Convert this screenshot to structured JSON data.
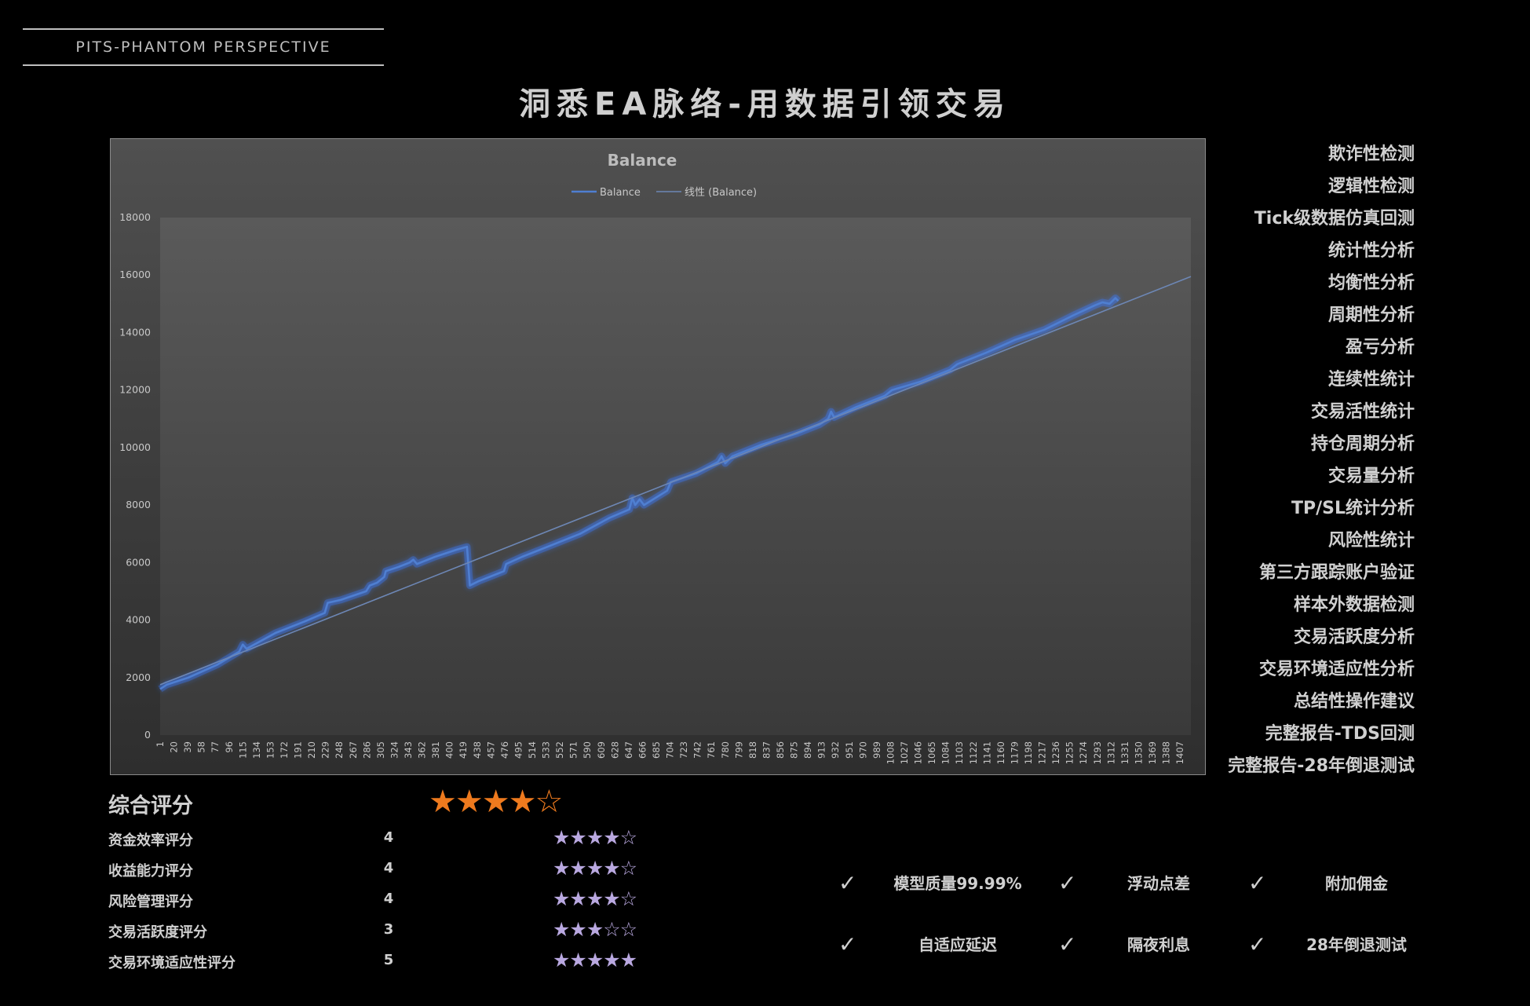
{
  "brand": "PITS-PHANTOM PERSPECTIVE",
  "main_title": "洞悉EA脉络-用数据引领交易",
  "chart_data": {
    "type": "line",
    "title": "Balance",
    "legend": [
      "Balance",
      "线性 (Balance)"
    ],
    "legend_position": "top",
    "ylim": [
      0,
      18000
    ],
    "yticks": [
      0,
      2000,
      4000,
      6000,
      8000,
      10000,
      12000,
      14000,
      16000,
      18000
    ],
    "xlim": [
      1,
      1422
    ],
    "xticks": [
      1,
      20,
      39,
      58,
      77,
      96,
      115,
      134,
      153,
      172,
      191,
      210,
      229,
      248,
      267,
      286,
      305,
      324,
      343,
      362,
      381,
      400,
      419,
      438,
      457,
      476,
      495,
      514,
      533,
      552,
      571,
      590,
      609,
      628,
      647,
      666,
      685,
      704,
      723,
      742,
      761,
      780,
      799,
      818,
      837,
      856,
      875,
      894,
      913,
      932,
      951,
      970,
      989,
      1008,
      1027,
      1046,
      1065,
      1084,
      1103,
      1122,
      1141,
      1160,
      1179,
      1198,
      1217,
      1236,
      1255,
      1274,
      1293,
      1312,
      1331,
      1350,
      1369,
      1388,
      1407
    ],
    "grid": false,
    "series": [
      {
        "name": "Balance",
        "color": "#4f7fd1",
        "points": [
          [
            1,
            1600
          ],
          [
            10,
            1750
          ],
          [
            40,
            2000
          ],
          [
            80,
            2450
          ],
          [
            110,
            2900
          ],
          [
            115,
            3150
          ],
          [
            120,
            3000
          ],
          [
            160,
            3550
          ],
          [
            200,
            3950
          ],
          [
            228,
            4250
          ],
          [
            232,
            4600
          ],
          [
            250,
            4700
          ],
          [
            285,
            5000
          ],
          [
            290,
            5200
          ],
          [
            300,
            5300
          ],
          [
            310,
            5500
          ],
          [
            312,
            5700
          ],
          [
            330,
            5850
          ],
          [
            345,
            6000
          ],
          [
            350,
            6100
          ],
          [
            355,
            5950
          ],
          [
            380,
            6200
          ],
          [
            410,
            6450
          ],
          [
            424,
            6550
          ],
          [
            428,
            5200
          ],
          [
            440,
            5350
          ],
          [
            475,
            5700
          ],
          [
            478,
            5950
          ],
          [
            500,
            6200
          ],
          [
            540,
            6600
          ],
          [
            580,
            7000
          ],
          [
            620,
            7550
          ],
          [
            648,
            7850
          ],
          [
            652,
            8250
          ],
          [
            656,
            8000
          ],
          [
            662,
            8200
          ],
          [
            668,
            8000
          ],
          [
            700,
            8500
          ],
          [
            705,
            8800
          ],
          [
            740,
            9100
          ],
          [
            770,
            9500
          ],
          [
            775,
            9700
          ],
          [
            780,
            9450
          ],
          [
            790,
            9700
          ],
          [
            830,
            10100
          ],
          [
            880,
            10500
          ],
          [
            910,
            10800
          ],
          [
            922,
            11000
          ],
          [
            926,
            11250
          ],
          [
            930,
            11050
          ],
          [
            960,
            11400
          ],
          [
            1000,
            11800
          ],
          [
            1010,
            12000
          ],
          [
            1050,
            12300
          ],
          [
            1090,
            12700
          ],
          [
            1100,
            12900
          ],
          [
            1140,
            13300
          ],
          [
            1180,
            13750
          ],
          [
            1220,
            14100
          ],
          [
            1260,
            14600
          ],
          [
            1290,
            14950
          ],
          [
            1300,
            15050
          ],
          [
            1310,
            15000
          ],
          [
            1318,
            15200
          ],
          [
            1322,
            15100
          ]
        ]
      },
      {
        "name": "线性 (Balance)",
        "color": "#6d87b5",
        "points": [
          [
            1,
            1750
          ],
          [
            1422,
            15950
          ]
        ]
      }
    ]
  },
  "side_items": [
    "欺诈性检测",
    "逻辑性检测",
    "Tick级数据仿真回测",
    "统计性分析",
    "均衡性分析",
    "周期性分析",
    "盈亏分析",
    "连续性统计",
    "交易活性统计",
    "持仓周期分析",
    "交易量分析",
    "TP/SL统计分析",
    "风险性统计",
    "第三方跟踪账户验证",
    "样本外数据检测",
    "交易活跃度分析",
    "交易环境适应性分析",
    "总结性操作建议",
    "完整报告-TDS回测",
    "完整报告-28年倒退测试"
  ],
  "overall": {
    "label": "综合评分",
    "stars": "★★★★☆"
  },
  "scores": [
    {
      "label": "资金效率评分",
      "value": "4",
      "stars": "★★★★☆"
    },
    {
      "label": "收益能力评分",
      "value": "4",
      "stars": "★★★★☆"
    },
    {
      "label": "风险管理评分",
      "value": "4",
      "stars": "★★★★☆"
    },
    {
      "label": "交易活跃度评分",
      "value": "3",
      "stars": "★★★☆☆"
    },
    {
      "label": "交易环境适应性评分",
      "value": "5",
      "stars": "★★★★★"
    }
  ],
  "features": [
    {
      "check": "✓",
      "label": "模型质量99.99%"
    },
    {
      "check": "✓",
      "label": "浮动点差"
    },
    {
      "check": "✓",
      "label": "附加佣金"
    },
    {
      "check": "✓",
      "label": "自适应延迟"
    },
    {
      "check": "✓",
      "label": "隔夜利息"
    },
    {
      "check": "✓",
      "label": "28年倒退测试"
    }
  ],
  "colors": {
    "overall_stars": "#ee7a1e",
    "score_stars": "#b9a8e0",
    "balance_line": "#4f7fd1"
  }
}
